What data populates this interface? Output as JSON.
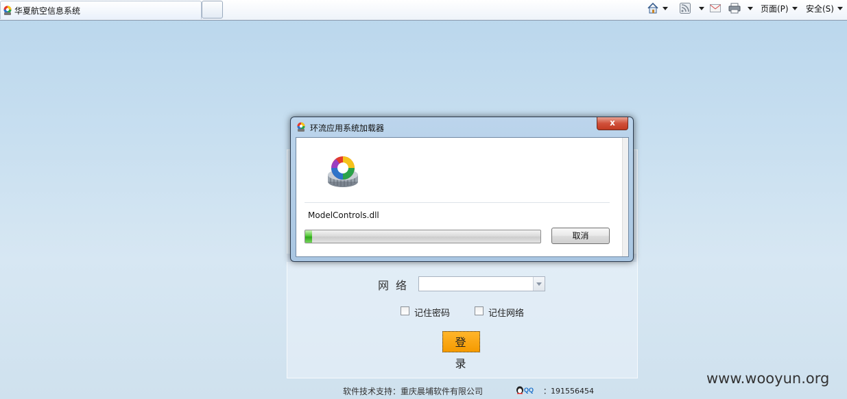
{
  "browser": {
    "tab_title": "华夏航空信息系统",
    "commands": {
      "page_label": "页面(P)",
      "safety_label": "安全(S)"
    },
    "icons": [
      "home-icon",
      "rss-icon",
      "mail-icon",
      "print-icon"
    ]
  },
  "login": {
    "network_label": "网络",
    "network_value": "",
    "remember_password_label": "记住密码",
    "remember_network_label": "记住网络",
    "login_button_label": "登录",
    "support_text": "软件技术支持：重庆晨埔软件有限公司",
    "qq_number": "：191556454"
  },
  "dialog": {
    "title": "环流应用系统加载器",
    "close_label": "x",
    "file_name": "ModelControls.dll",
    "progress_fraction": 0.03,
    "cancel_label": "取消"
  },
  "watermark": "www.wooyun.org",
  "colors": {
    "page_background": "#c8dff0",
    "login_button": "#f7a50a",
    "progress_green": "#3db322",
    "close_red": "#c8452c"
  }
}
